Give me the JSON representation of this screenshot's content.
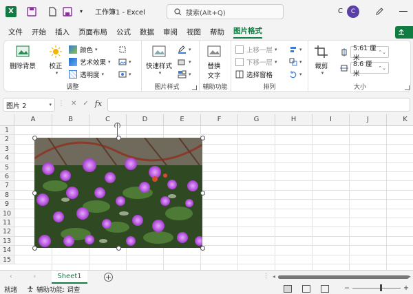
{
  "titlebar": {
    "title": "工作簿1  -  Excel",
    "search_placeholder": "搜索(Alt+Q)",
    "user_initial": "C",
    "avatar_letter": "C"
  },
  "menu": {
    "tabs": [
      "文件",
      "开始",
      "插入",
      "页面布局",
      "公式",
      "数据",
      "审阅",
      "视图",
      "帮助",
      "图片格式"
    ],
    "active_tab": "图片格式"
  },
  "ribbon": {
    "remove_bg": "删除背景",
    "correct": "校正",
    "color": "颜色",
    "art_effects": "艺术效果",
    "transparency": "透明度",
    "group_adjust": "调整",
    "quick_styles": "快速样式",
    "group_picture_styles": "图片样式",
    "alt_text_line1": "替换",
    "alt_text_line2": "文字",
    "group_accessibility": "辅助功能",
    "bring_forward": "上移一层",
    "send_backward": "下移一层",
    "selection_pane": "选择窗格",
    "group_arrange": "排列",
    "crop": "裁剪",
    "height": "5.61 厘米",
    "width": "8.6 厘米",
    "group_size": "大小"
  },
  "formula_bar": {
    "name_box": "图片 2",
    "fx": "fx",
    "formula": ""
  },
  "grid": {
    "columns": [
      "A",
      "B",
      "C",
      "D",
      "E",
      "F",
      "G",
      "H",
      "I",
      "J",
      "K"
    ],
    "rows": [
      "1",
      "2",
      "3",
      "4",
      "5",
      "6",
      "7",
      "8",
      "9",
      "10",
      "11",
      "12",
      "13",
      "14",
      "15"
    ]
  },
  "sheets": {
    "tabs": [
      "Sheet1"
    ],
    "active": "Sheet1"
  },
  "status": {
    "ready": "就绪",
    "accessibility": "辅助功能: 调查"
  },
  "colors": {
    "accent": "#107c41",
    "flower": "#b040d8",
    "avatar": "#5b3fa8"
  }
}
